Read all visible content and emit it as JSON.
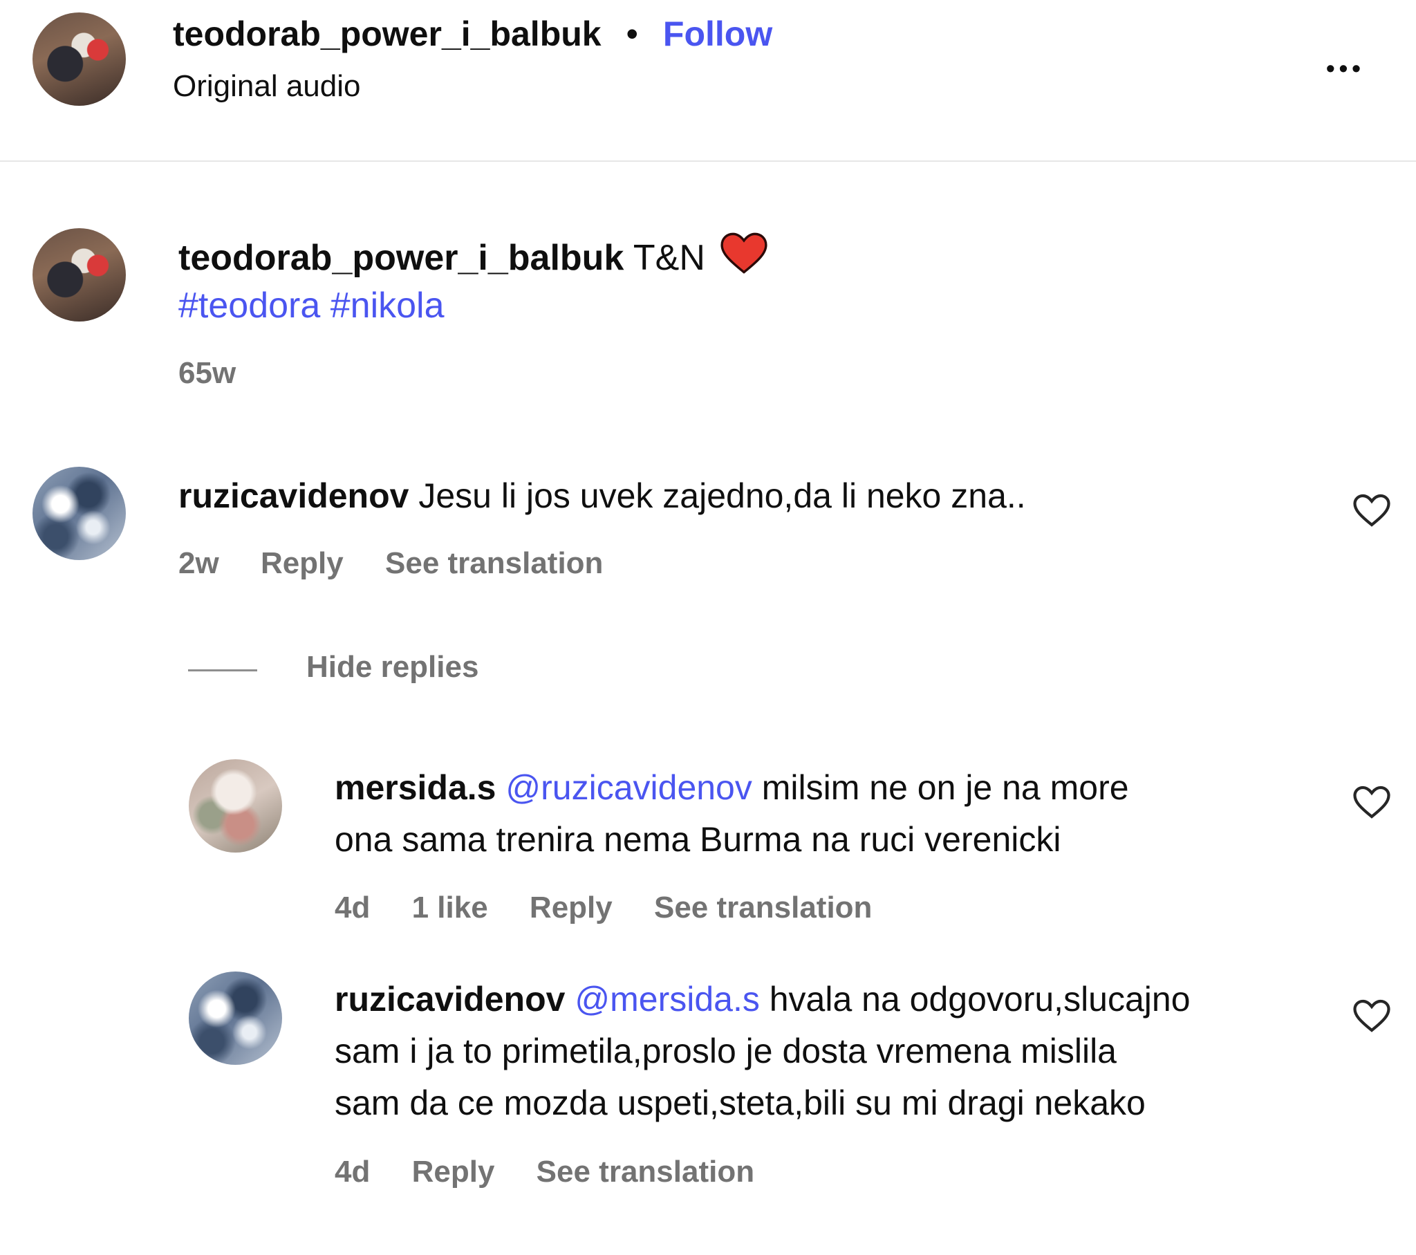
{
  "header": {
    "username": "teodorab_power_i_balbuk",
    "separator": "•",
    "follow_label": "Follow",
    "audio_label": "Original audio",
    "more_label": "•••"
  },
  "caption": {
    "username": "teodorab_power_i_balbuk",
    "text": "T&N",
    "hashtags": "#teodora #nikola",
    "time": "65w"
  },
  "comments": [
    {
      "username": "ruzicavidenov",
      "text": "Jesu li jos uvek zajedno,da li neko zna..",
      "time": "2w",
      "reply_label": "Reply",
      "translation_label": "See translation"
    }
  ],
  "replies_toggle": {
    "label": "Hide replies"
  },
  "replies": [
    {
      "username": "mersida.s",
      "mention": "@ruzicavidenov",
      "text_line1": "milsim ne on je na more",
      "text_line2": "ona sama trenira nema Burma na ruci verenicki",
      "time": "4d",
      "likes": "1 like",
      "reply_label": "Reply",
      "translation_label": "See translation"
    },
    {
      "username": "ruzicavidenov",
      "mention": "@mersida.s",
      "text_line1": "hvala na odgovoru,slucajno",
      "text_line2": "sam i ja to primetila,proslo je dosta vremena mislila",
      "text_line3": "sam da ce mozda uspeti,steta,bili su mi dragi nekako",
      "time": "4d",
      "reply_label": "Reply",
      "translation_label": "See translation"
    }
  ],
  "colors": {
    "link_blue": "#4a55f0",
    "heart_red": "#e8382e",
    "meta_grey": "#737373"
  }
}
